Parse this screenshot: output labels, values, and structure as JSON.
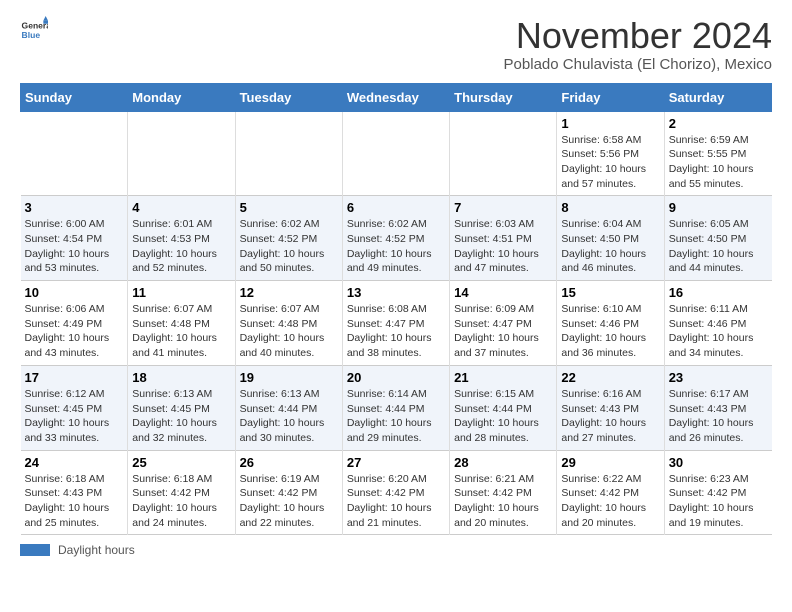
{
  "header": {
    "logo_general": "General",
    "logo_blue": "Blue",
    "month_title": "November 2024",
    "subtitle": "Poblado Chulavista (El Chorizo), Mexico"
  },
  "footer": {
    "daylight_label": "Daylight hours"
  },
  "days_of_week": [
    "Sunday",
    "Monday",
    "Tuesday",
    "Wednesday",
    "Thursday",
    "Friday",
    "Saturday"
  ],
  "weeks": [
    [
      {
        "day": "",
        "info": ""
      },
      {
        "day": "",
        "info": ""
      },
      {
        "day": "",
        "info": ""
      },
      {
        "day": "",
        "info": ""
      },
      {
        "day": "",
        "info": ""
      },
      {
        "day": "1",
        "info": "Sunrise: 6:58 AM\nSunset: 5:56 PM\nDaylight: 10 hours and 57 minutes."
      },
      {
        "day": "2",
        "info": "Sunrise: 6:59 AM\nSunset: 5:55 PM\nDaylight: 10 hours and 55 minutes."
      }
    ],
    [
      {
        "day": "3",
        "info": "Sunrise: 6:00 AM\nSunset: 4:54 PM\nDaylight: 10 hours and 53 minutes."
      },
      {
        "day": "4",
        "info": "Sunrise: 6:01 AM\nSunset: 4:53 PM\nDaylight: 10 hours and 52 minutes."
      },
      {
        "day": "5",
        "info": "Sunrise: 6:02 AM\nSunset: 4:52 PM\nDaylight: 10 hours and 50 minutes."
      },
      {
        "day": "6",
        "info": "Sunrise: 6:02 AM\nSunset: 4:52 PM\nDaylight: 10 hours and 49 minutes."
      },
      {
        "day": "7",
        "info": "Sunrise: 6:03 AM\nSunset: 4:51 PM\nDaylight: 10 hours and 47 minutes."
      },
      {
        "day": "8",
        "info": "Sunrise: 6:04 AM\nSunset: 4:50 PM\nDaylight: 10 hours and 46 minutes."
      },
      {
        "day": "9",
        "info": "Sunrise: 6:05 AM\nSunset: 4:50 PM\nDaylight: 10 hours and 44 minutes."
      }
    ],
    [
      {
        "day": "10",
        "info": "Sunrise: 6:06 AM\nSunset: 4:49 PM\nDaylight: 10 hours and 43 minutes."
      },
      {
        "day": "11",
        "info": "Sunrise: 6:07 AM\nSunset: 4:48 PM\nDaylight: 10 hours and 41 minutes."
      },
      {
        "day": "12",
        "info": "Sunrise: 6:07 AM\nSunset: 4:48 PM\nDaylight: 10 hours and 40 minutes."
      },
      {
        "day": "13",
        "info": "Sunrise: 6:08 AM\nSunset: 4:47 PM\nDaylight: 10 hours and 38 minutes."
      },
      {
        "day": "14",
        "info": "Sunrise: 6:09 AM\nSunset: 4:47 PM\nDaylight: 10 hours and 37 minutes."
      },
      {
        "day": "15",
        "info": "Sunrise: 6:10 AM\nSunset: 4:46 PM\nDaylight: 10 hours and 36 minutes."
      },
      {
        "day": "16",
        "info": "Sunrise: 6:11 AM\nSunset: 4:46 PM\nDaylight: 10 hours and 34 minutes."
      }
    ],
    [
      {
        "day": "17",
        "info": "Sunrise: 6:12 AM\nSunset: 4:45 PM\nDaylight: 10 hours and 33 minutes."
      },
      {
        "day": "18",
        "info": "Sunrise: 6:13 AM\nSunset: 4:45 PM\nDaylight: 10 hours and 32 minutes."
      },
      {
        "day": "19",
        "info": "Sunrise: 6:13 AM\nSunset: 4:44 PM\nDaylight: 10 hours and 30 minutes."
      },
      {
        "day": "20",
        "info": "Sunrise: 6:14 AM\nSunset: 4:44 PM\nDaylight: 10 hours and 29 minutes."
      },
      {
        "day": "21",
        "info": "Sunrise: 6:15 AM\nSunset: 4:44 PM\nDaylight: 10 hours and 28 minutes."
      },
      {
        "day": "22",
        "info": "Sunrise: 6:16 AM\nSunset: 4:43 PM\nDaylight: 10 hours and 27 minutes."
      },
      {
        "day": "23",
        "info": "Sunrise: 6:17 AM\nSunset: 4:43 PM\nDaylight: 10 hours and 26 minutes."
      }
    ],
    [
      {
        "day": "24",
        "info": "Sunrise: 6:18 AM\nSunset: 4:43 PM\nDaylight: 10 hours and 25 minutes."
      },
      {
        "day": "25",
        "info": "Sunrise: 6:18 AM\nSunset: 4:42 PM\nDaylight: 10 hours and 24 minutes."
      },
      {
        "day": "26",
        "info": "Sunrise: 6:19 AM\nSunset: 4:42 PM\nDaylight: 10 hours and 22 minutes."
      },
      {
        "day": "27",
        "info": "Sunrise: 6:20 AM\nSunset: 4:42 PM\nDaylight: 10 hours and 21 minutes."
      },
      {
        "day": "28",
        "info": "Sunrise: 6:21 AM\nSunset: 4:42 PM\nDaylight: 10 hours and 20 minutes."
      },
      {
        "day": "29",
        "info": "Sunrise: 6:22 AM\nSunset: 4:42 PM\nDaylight: 10 hours and 20 minutes."
      },
      {
        "day": "30",
        "info": "Sunrise: 6:23 AM\nSunset: 4:42 PM\nDaylight: 10 hours and 19 minutes."
      }
    ]
  ]
}
